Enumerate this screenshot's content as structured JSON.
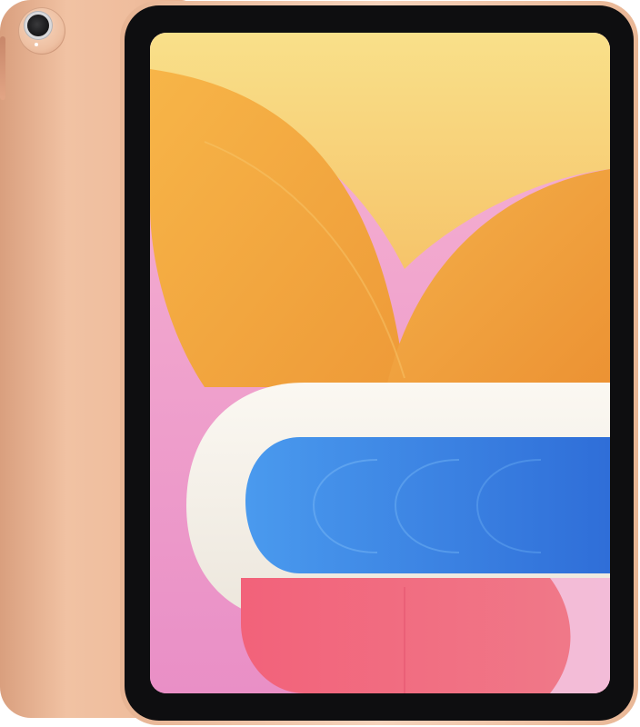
{
  "scene": {
    "subject": "tablet",
    "finish_color": "#efbd9d",
    "bezel_color": "#0e0e10",
    "wallpaper_colors": {
      "sky": "#f9d87a",
      "orange": "#f2a53d",
      "pink": "#f3a9cf",
      "cream": "#f7f3ec",
      "blue": "#3f85e6",
      "red": "#f06a7c"
    },
    "icons": {
      "camera": "camera-icon"
    }
  }
}
